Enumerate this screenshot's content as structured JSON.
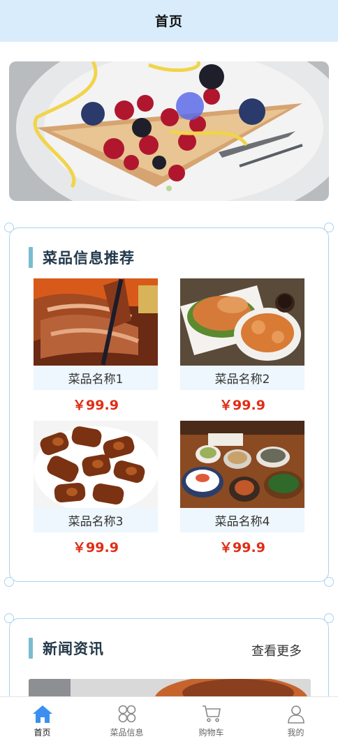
{
  "header": {
    "title": "首页"
  },
  "banner": {
    "image": "berry-tart-dessert-plate"
  },
  "recommend": {
    "title": "菜品信息推荐",
    "items": [
      {
        "name": "菜品名称1",
        "price": "￥99.9",
        "image": "braised-duck"
      },
      {
        "name": "菜品名称2",
        "price": "￥99.9",
        "image": "braised-pork-trotter"
      },
      {
        "name": "菜品名称3",
        "price": "￥99.9",
        "image": "braised-intestine"
      },
      {
        "name": "菜品名称4",
        "price": "￥99.9",
        "image": "japanese-set-meal"
      }
    ]
  },
  "news": {
    "title": "新闻资讯",
    "more": "查看更多"
  },
  "tabbar": {
    "items": [
      {
        "label": "首页",
        "icon": "home-icon",
        "active": true
      },
      {
        "label": "菜品信息",
        "icon": "grid-icon",
        "active": false
      },
      {
        "label": "购物车",
        "icon": "cart-icon",
        "active": false
      },
      {
        "label": "我的",
        "icon": "user-icon",
        "active": false
      }
    ]
  },
  "colors": {
    "accent": "#3a8ff0",
    "price": "#e02d14",
    "header_bg": "#d8ecfb",
    "section_bar": "#79bcd0",
    "card_border": "#a9d3ef"
  }
}
